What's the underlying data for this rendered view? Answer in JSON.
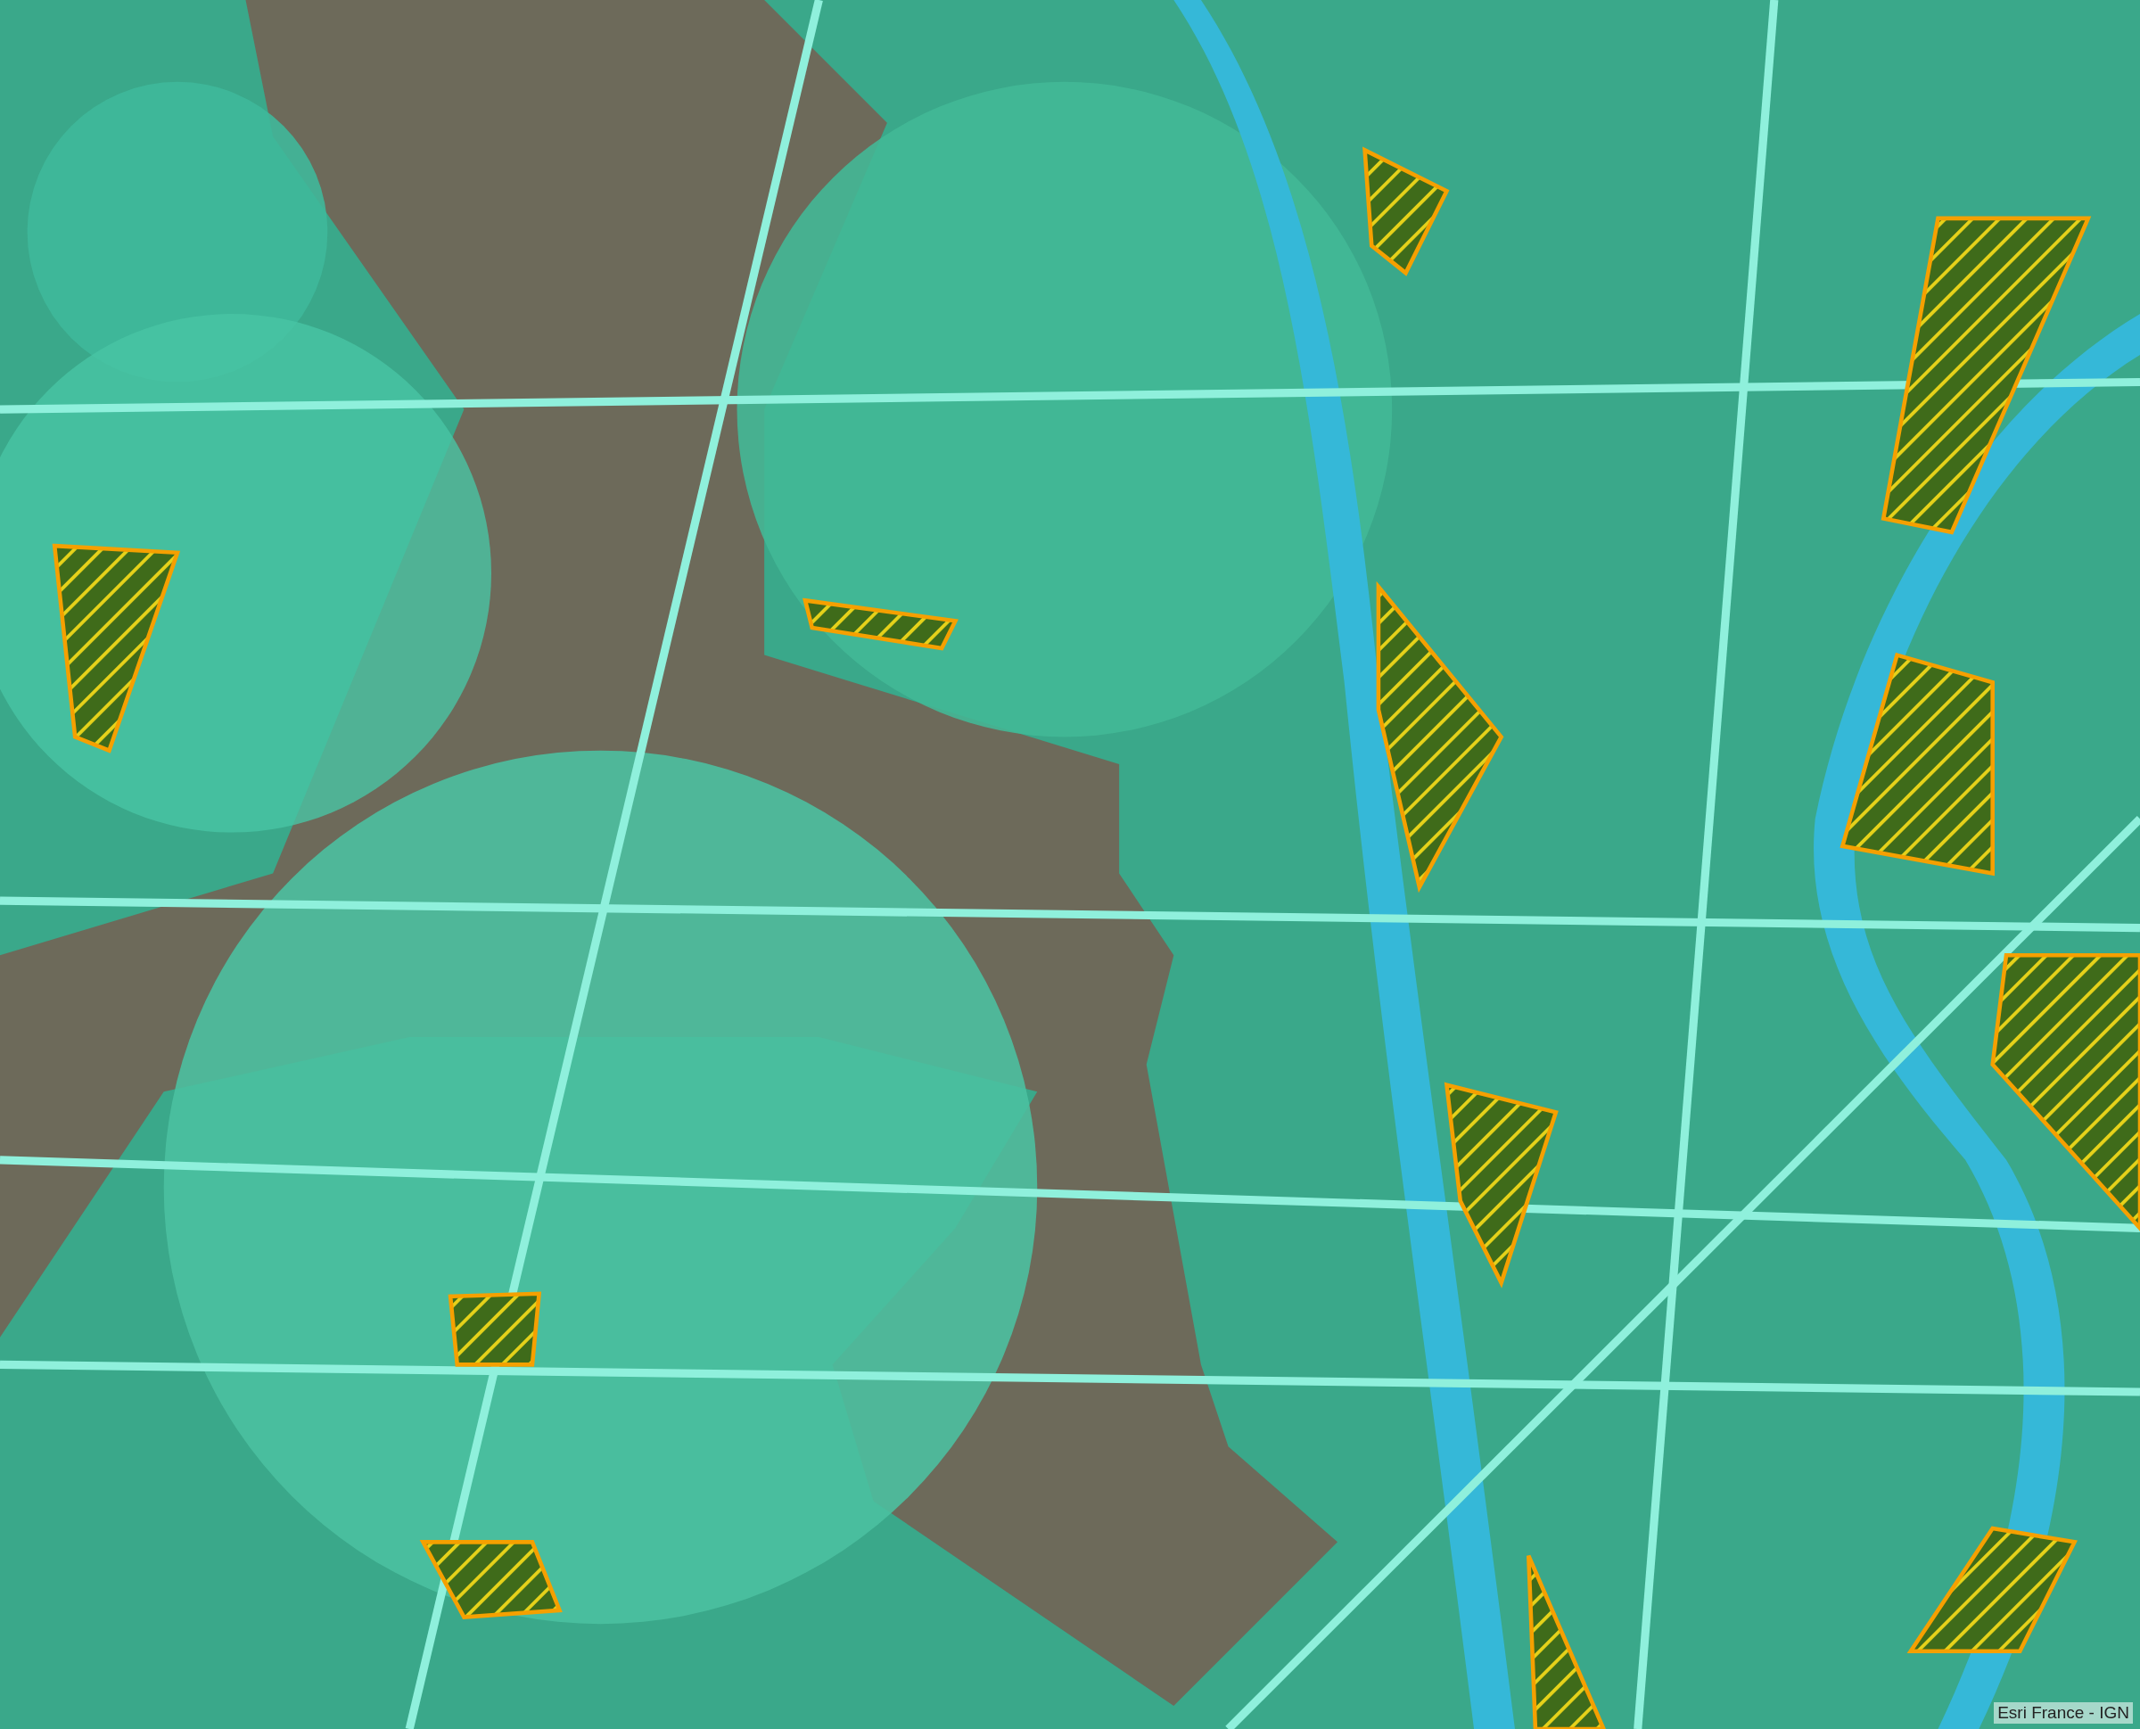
{
  "map": {
    "attribution": "Esri France - IGN"
  }
}
